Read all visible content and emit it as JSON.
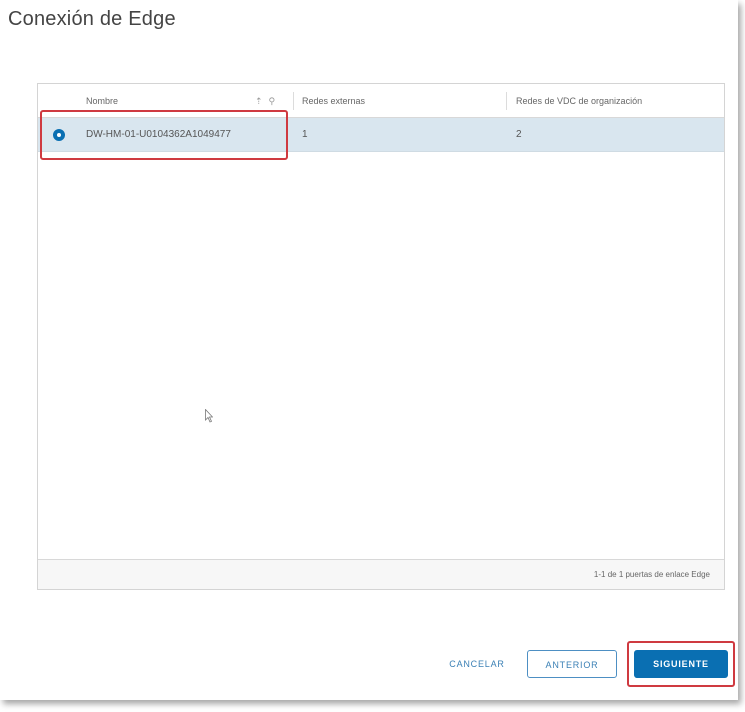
{
  "dialog": {
    "title": "Conexión de Edge"
  },
  "table": {
    "columns": [
      "Nombre",
      "Redes externas",
      "Redes de VDC de organización"
    ],
    "rows": [
      {
        "name": "DW-HM-01-U0104362A1049477",
        "external_networks": "1",
        "org_vdc_networks": "2",
        "selected": true
      }
    ],
    "footer": "1-1 de 1 puertas de enlace Edge"
  },
  "buttons": {
    "cancel": "CANCELAR",
    "previous": "ANTERIOR",
    "next": "SIGUIENTE"
  },
  "colors": {
    "accent": "#0a6fb2",
    "highlight": "#cf3a40",
    "selected_row": "#d9e6ef"
  }
}
